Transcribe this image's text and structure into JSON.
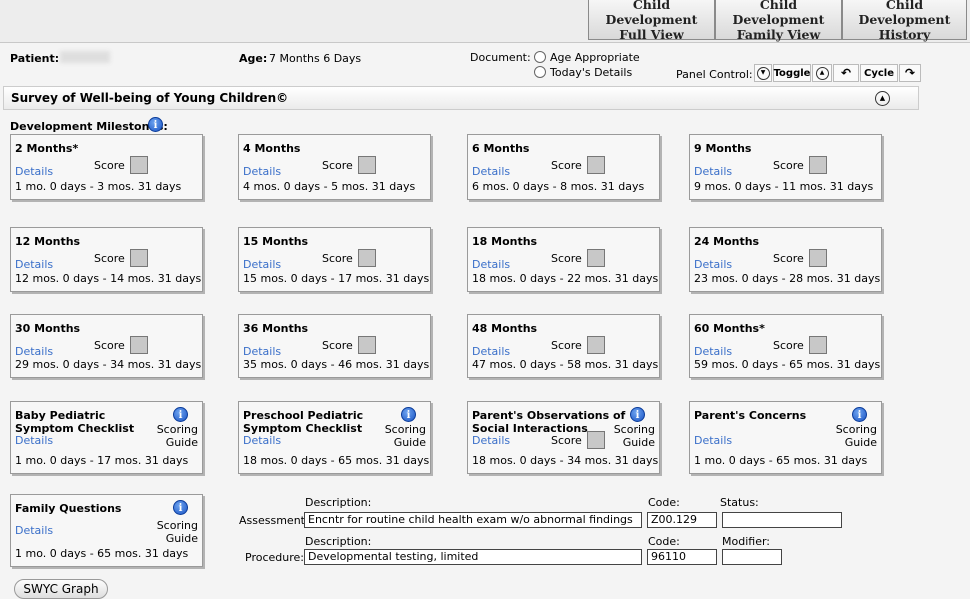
{
  "tabs": [
    {
      "line1": "Child Development",
      "line2": "Full View"
    },
    {
      "line1": "Child Development",
      "line2": "Family View"
    },
    {
      "line1": "Child Development",
      "line2": "History"
    }
  ],
  "header": {
    "patient_label": "Patient:",
    "age_label": "Age:",
    "age_value": "7 Months 6 Days",
    "document_label": "Document:",
    "radio_options": [
      "Age Appropriate",
      "Today's Details"
    ],
    "panel_control_label": "Panel Control:",
    "toggle_label": "Toggle",
    "cycle_label": "Cycle"
  },
  "section": {
    "title": "Survey of Well-being of Young Children©",
    "milestones_label": "Development Milestones:"
  },
  "common": {
    "details": "Details",
    "score": "Score",
    "scoring_line1": "Scoring",
    "scoring_line2": "Guide"
  },
  "milestones": [
    {
      "title": "2 Months*",
      "range": "1 mo. 0 days - 3 mos. 31 days"
    },
    {
      "title": "4 Months",
      "range": "4 mos. 0 days - 5 mos. 31 days"
    },
    {
      "title": "6 Months",
      "range": "6 mos. 0 days - 8 mos. 31 days"
    },
    {
      "title": "9 Months",
      "range": "9 mos. 0 days - 11 mos. 31 days"
    },
    {
      "title": "12 Months",
      "range": "12 mos. 0 days - 14 mos. 31 days"
    },
    {
      "title": "15 Months",
      "range": "15 mos. 0 days - 17 mos. 31 days"
    },
    {
      "title": "18 Months",
      "range": "18 mos. 0 days - 22 mos. 31 days"
    },
    {
      "title": "24 Months",
      "range": "23 mos. 0 days - 28 mos. 31 days"
    },
    {
      "title": "30 Months",
      "range": "29 mos. 0 days - 34 mos. 31 days"
    },
    {
      "title": "36 Months",
      "range": "35 mos. 0 days - 46 mos. 31 days"
    },
    {
      "title": "48 Months",
      "range": "47 mos. 0 days - 58 mos. 31 days"
    },
    {
      "title": "60 Months*",
      "range": "59 mos. 0 days - 65 mos. 31 days"
    }
  ],
  "checklists": [
    {
      "title_line1": "Baby Pediatric",
      "title_line2": "Symptom Checklist",
      "range": "1 mo. 0 days - 17 mos. 31 days"
    },
    {
      "title_line1": "Preschool Pediatric",
      "title_line2": "Symptom Checklist",
      "range": "18 mos. 0 days - 65 mos. 31 days"
    },
    {
      "title_line1": "Parent's Observations of",
      "title_line2": "Social Interactions",
      "range": "18 mos. 0 days - 34 mos. 31 days"
    },
    {
      "title_line1": "Parent's Concerns",
      "title_line2": "",
      "range": "1 mo. 0 days - 65 mos. 31 days"
    },
    {
      "title_line1": "Family Questions",
      "title_line2": "",
      "range": "1 mo. 0 days - 65 mos. 31 days"
    }
  ],
  "assessment": {
    "label": "Assessment:",
    "description_label": "Description:",
    "description": "Encntr for routine child health exam w/o abnormal findings",
    "code_label": "Code:",
    "code": "Z00.129",
    "status_label": "Status:",
    "status": ""
  },
  "procedure": {
    "label": "Procedure:",
    "description_label": "Description:",
    "description": "Developmental testing, limited",
    "code_label": "Code:",
    "code": "96110",
    "modifier_label": "Modifier:",
    "modifier": ""
  },
  "graph_button": "SWYC Graph",
  "colors": {
    "link": "#3a6fc9",
    "score_box": "#c8c8c8",
    "info_blue": "#1a54c4"
  }
}
